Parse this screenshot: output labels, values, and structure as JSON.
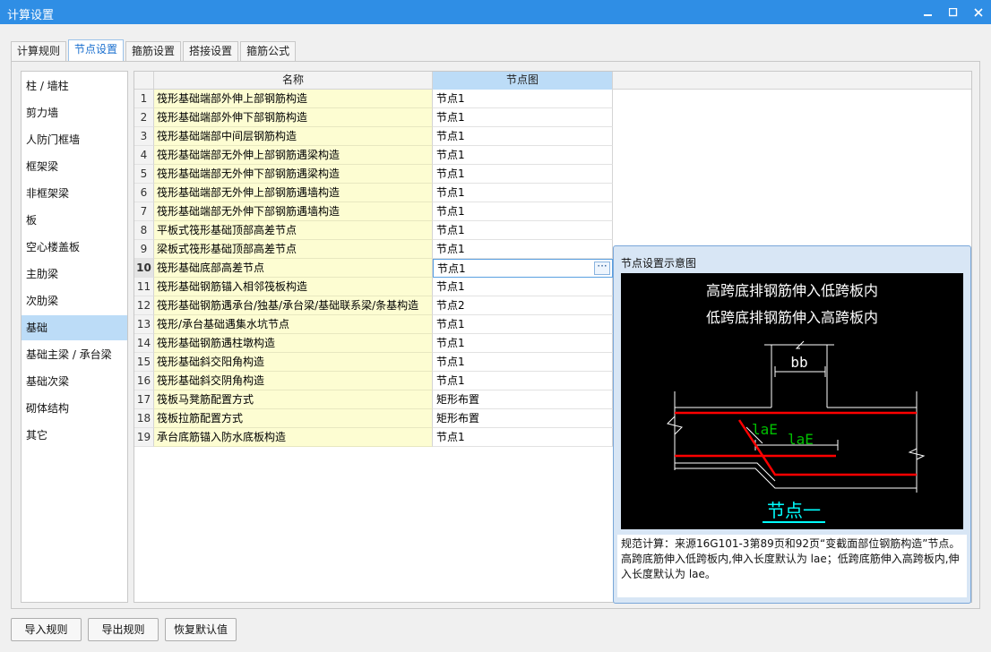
{
  "window": {
    "title": "计算设置"
  },
  "tabs": [
    {
      "label": "计算规则",
      "active": false
    },
    {
      "label": "节点设置",
      "active": true
    },
    {
      "label": "箍筋设置",
      "active": false
    },
    {
      "label": "搭接设置",
      "active": false
    },
    {
      "label": "箍筋公式",
      "active": false
    }
  ],
  "sidebar": {
    "selected": "基础",
    "items": [
      "柱 / 墙柱",
      "剪力墙",
      "人防门框墙",
      "框架梁",
      "非框架梁",
      "板",
      "空心楼盖板",
      "主肋梁",
      "次肋梁",
      "基础",
      "基础主梁 / 承台梁",
      "基础次梁",
      "砌体结构",
      "其它"
    ]
  },
  "grid": {
    "columns": {
      "name": "名称",
      "node": "节点图"
    },
    "selected_row": 10,
    "rows": [
      {
        "num": "1",
        "name": "筏形基础端部外伸上部钢筋构造",
        "node": "节点1"
      },
      {
        "num": "2",
        "name": "筏形基础端部外伸下部钢筋构造",
        "node": "节点1"
      },
      {
        "num": "3",
        "name": "筏形基础端部中间层钢筋构造",
        "node": "节点1"
      },
      {
        "num": "4",
        "name": "筏形基础端部无外伸上部钢筋遇梁构造",
        "node": "节点1"
      },
      {
        "num": "5",
        "name": "筏形基础端部无外伸下部钢筋遇梁构造",
        "node": "节点1"
      },
      {
        "num": "6",
        "name": "筏形基础端部无外伸上部钢筋遇墙构造",
        "node": "节点1"
      },
      {
        "num": "7",
        "name": "筏形基础端部无外伸下部钢筋遇墙构造",
        "node": "节点1"
      },
      {
        "num": "8",
        "name": "平板式筏形基础顶部高差节点",
        "node": "节点1"
      },
      {
        "num": "9",
        "name": "梁板式筏形基础顶部高差节点",
        "node": "节点1"
      },
      {
        "num": "10",
        "name": "筏形基础底部高差节点",
        "node": "节点1"
      },
      {
        "num": "11",
        "name": "筏形基础钢筋锚入相邻筏板构造",
        "node": "节点1"
      },
      {
        "num": "12",
        "name": "筏形基础钢筋遇承台/独基/承台梁/基础联系梁/条基构造",
        "node": "节点2"
      },
      {
        "num": "13",
        "name": "筏形/承台基础遇集水坑节点",
        "node": "节点1"
      },
      {
        "num": "14",
        "name": "筏形基础钢筋遇柱墩构造",
        "node": "节点1"
      },
      {
        "num": "15",
        "name": "筏形基础斜交阳角构造",
        "node": "节点1"
      },
      {
        "num": "16",
        "name": "筏形基础斜交阴角构造",
        "node": "节点1"
      },
      {
        "num": "17",
        "name": "筏板马凳筋配置方式",
        "node": "矩形布置"
      },
      {
        "num": "18",
        "name": "筏板拉筋配置方式",
        "node": "矩形布置"
      },
      {
        "num": "19",
        "name": "承台底筋锚入防水底板构造",
        "node": "节点1"
      }
    ]
  },
  "preview": {
    "title": "节点设置示意图",
    "diagram": {
      "line1": "高跨底排钢筋伸入低跨板内",
      "line2": "低跨底排钢筋伸入高跨板内",
      "dim_label": "bb",
      "anchor_label_1": "laE",
      "anchor_label_2": "laE",
      "node_label": "节点一",
      "colors": {
        "background": "#000000",
        "concrete": "#ffffff",
        "rebar": "#ff0000",
        "anchor_text": "#00c000",
        "node_text": "#00ffff"
      }
    },
    "description": "规范计算：来源16G101-3第89页和92页“变截面部位钢筋构造”节点。高跨底筋伸入低跨板内,伸入长度默认为 lae；低跨底筋伸入高跨板内,伸入长度默认为 lae。"
  },
  "footer": {
    "import_label": "导入规则",
    "export_label": "导出规则",
    "restore_label": "恢复默认值"
  }
}
